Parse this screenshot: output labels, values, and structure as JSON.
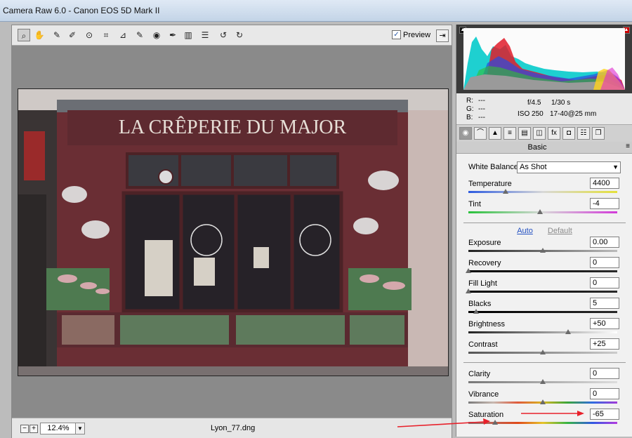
{
  "window": {
    "title": "Camera Raw 6.0  -  Canon EOS 5D Mark II"
  },
  "toolbar": {
    "tools": [
      "zoom-icon",
      "hand-icon",
      "white-balance-icon",
      "color-sampler-icon",
      "target-adjust-icon",
      "crop-icon",
      "straighten-icon",
      "spot-removal-icon",
      "red-eye-icon",
      "adjustment-brush-icon",
      "graduated-filter-icon",
      "preferences-icon",
      "rotate-left-icon",
      "rotate-right-icon"
    ],
    "preview_label": "Preview",
    "preview_checked": true,
    "fullscreen_icon": "fullscreen-icon"
  },
  "photo": {
    "sign_text": "LA CRÊPERIE DU MAJOR",
    "window_text": "LA CRÊPERIE DU MAJOR"
  },
  "status": {
    "zoom": "12.4%",
    "filename": "Lyon_77.dng"
  },
  "info": {
    "r_label": "R:",
    "r": "---",
    "g_label": "G:",
    "g": "---",
    "b_label": "B:",
    "b": "---",
    "aperture": "f/4.5",
    "shutter": "1/30 s",
    "iso": "ISO 250",
    "lens": "17-40@25 mm"
  },
  "panel": {
    "title": "Basic",
    "white_balance_label": "White Balance:",
    "white_balance_value": "As Shot",
    "auto_label": "Auto",
    "default_label": "Default",
    "sliders": [
      {
        "label": "Temperature",
        "value": "4400",
        "level": 0.25
      },
      {
        "label": "Tint",
        "value": "-4",
        "level": 0.48
      },
      {
        "label": "Exposure",
        "value": "0.00",
        "level": 0.5
      },
      {
        "label": "Recovery",
        "value": "0",
        "level": 0.0
      },
      {
        "label": "Fill Light",
        "value": "0",
        "level": 0.0
      },
      {
        "label": "Blacks",
        "value": "5",
        "level": 0.05
      },
      {
        "label": "Brightness",
        "value": "+50",
        "level": 0.67
      },
      {
        "label": "Contrast",
        "value": "+25",
        "level": 0.5
      },
      {
        "label": "Clarity",
        "value": "0",
        "level": 0.5
      },
      {
        "label": "Vibrance",
        "value": "0",
        "level": 0.5
      },
      {
        "label": "Saturation",
        "value": "-65",
        "level": 0.18
      }
    ]
  },
  "colors": {
    "annotation_arrow": "#e8202a",
    "accent": "#2451c2"
  }
}
